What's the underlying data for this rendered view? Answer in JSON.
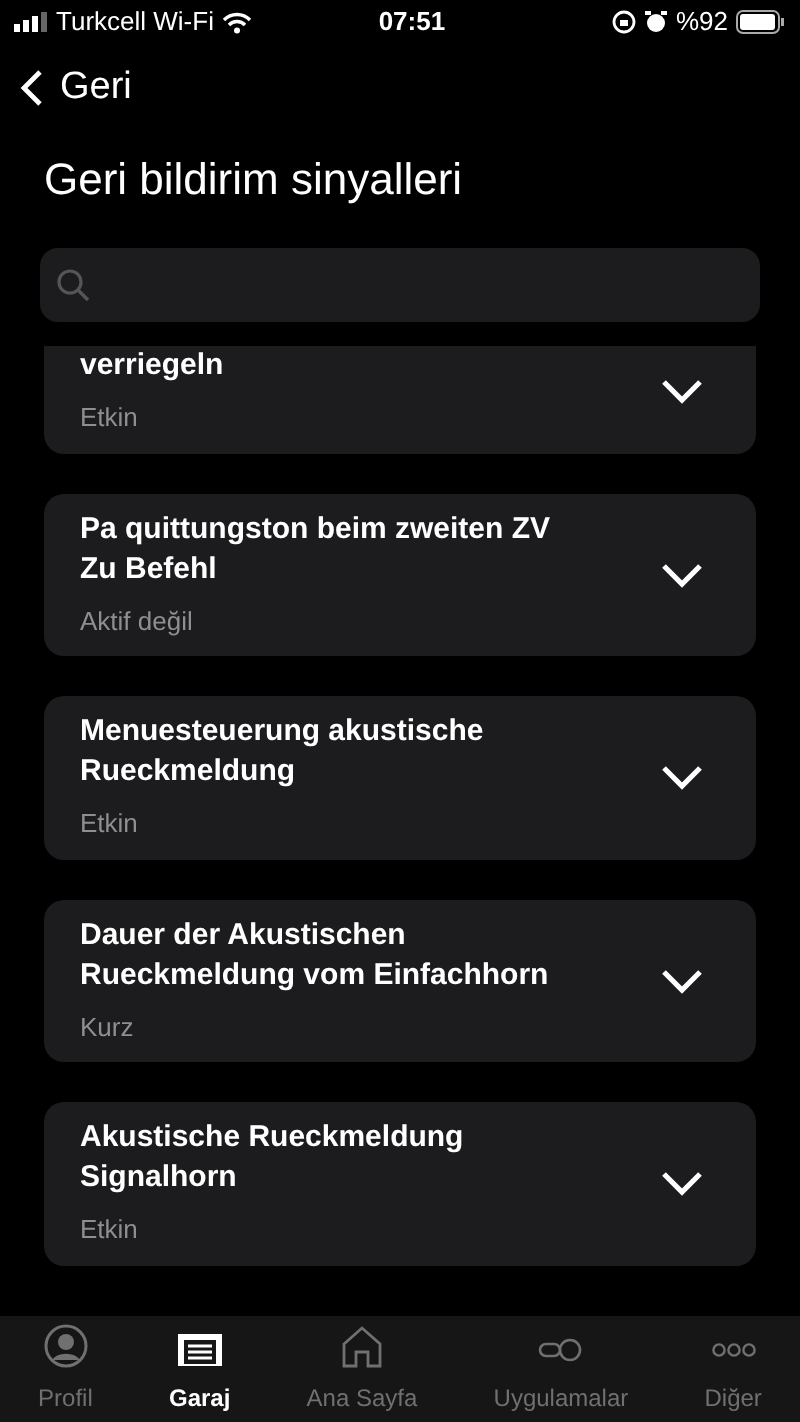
{
  "status_bar": {
    "carrier": "Turkcell Wi-Fi",
    "time": "07:51",
    "battery": "%92"
  },
  "back": {
    "label": "Geri"
  },
  "title": "Geri bildirim sinyalleri",
  "items": [
    {
      "title": "verriegeln",
      "value": "Etkin",
      "cut": true
    },
    {
      "title": "Pa quittungston beim zweiten ZV Zu Befehl",
      "value": "Aktif değil",
      "cut": false
    },
    {
      "title": "Menuesteuerung akustische Rueckmeldung",
      "value": "Etkin",
      "cut": false
    },
    {
      "title": "Dauer der Akustischen Rueckmeldung vom Einfachhorn",
      "value": "Kurz",
      "cut": false
    },
    {
      "title": "Akustische Rueckmeldung Signalhorn",
      "value": "Etkin",
      "cut": false
    }
  ],
  "tab_bar": [
    {
      "label": "Profil",
      "kind": "profile",
      "selected": false
    },
    {
      "label": "Garaj",
      "kind": "garage",
      "selected": true
    },
    {
      "label": "Ana Sayfa",
      "kind": "home",
      "selected": false
    },
    {
      "label": "Uygulamalar",
      "kind": "apps",
      "selected": false
    },
    {
      "label": "Diğer",
      "kind": "more",
      "selected": false
    }
  ]
}
